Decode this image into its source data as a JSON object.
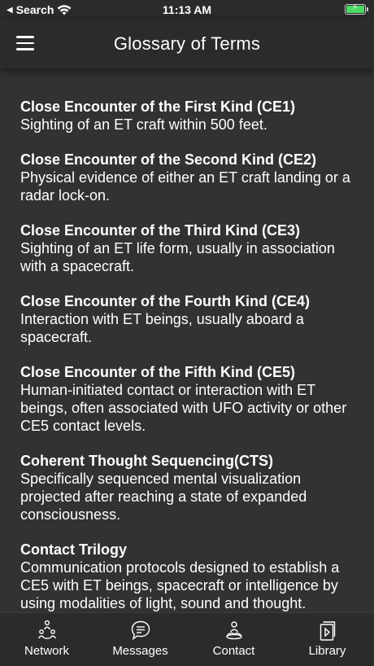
{
  "status_bar": {
    "back_label": "Search",
    "time": "11:13 AM"
  },
  "header": {
    "title": "Glossary of Terms"
  },
  "glossary": [
    {
      "term": "Close Encounter of the First Kind (CE1)",
      "definition": "Sighting of an ET craft within 500 feet."
    },
    {
      "term": "Close Encounter of the Second Kind (CE2)",
      "definition": "Physical evidence of either an ET craft landing or a radar lock-on."
    },
    {
      "term": "Close Encounter of the Third Kind (CE3)",
      "definition": "Sighting of an ET life form, usually in association with a spacecraft."
    },
    {
      "term": "Close Encounter of the Fourth Kind (CE4)",
      "definition": "Interaction with ET beings, usually aboard a spacecraft."
    },
    {
      "term": "Close Encounter of the Fifth Kind (CE5)",
      "definition": "Human-initiated contact or interaction with ET beings, often associated with UFO activity or other CE5 contact levels."
    },
    {
      "term": "Coherent Thought Sequencing(CTS)",
      "definition": "Specifically sequenced mental visualization projected after reaching a state of expanded consciousness."
    },
    {
      "term": "Contact Trilogy",
      "definition": "Communication protocols designed to establish a CE5 with ET beings, spacecraft or intelligence by using modalities of light, sound and thought."
    }
  ],
  "tabs": [
    {
      "label": "Network",
      "icon": "network-icon"
    },
    {
      "label": "Messages",
      "icon": "messages-icon"
    },
    {
      "label": "Contact",
      "icon": "contact-icon"
    },
    {
      "label": "Library",
      "icon": "library-icon"
    }
  ],
  "colors": {
    "background": "#323232",
    "bar_background": "#2b2b2b",
    "text": "#ffffff",
    "battery_fill": "#4cd964"
  }
}
